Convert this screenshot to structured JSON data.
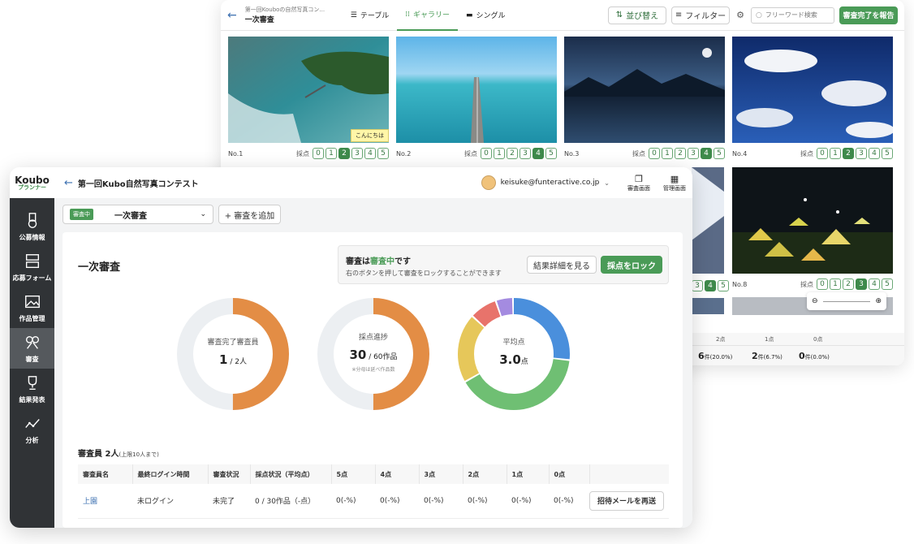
{
  "back_window": {
    "contest_short": "第一回Kouboの自然写真コン...",
    "stage_title": "一次審査",
    "views": [
      "テーブル",
      "ギャラリー",
      "シングル"
    ],
    "sort_label": "並び替え",
    "filter_label": "フィルター",
    "search_placeholder": "フリーワード検索",
    "report_label": "審査完了を報告",
    "score_label": "採点",
    "score_digits": [
      "0",
      "1",
      "2",
      "3",
      "4",
      "5"
    ],
    "tooltip": "こんにちは",
    "cards": [
      {
        "no": "No.1",
        "selected": 2
      },
      {
        "no": "No.2",
        "selected": 4
      },
      {
        "no": "No.3",
        "selected": 4
      },
      {
        "no": "No.4",
        "selected": 2
      }
    ],
    "row2_cards": [
      {
        "no": "No.8",
        "selected": 3
      }
    ],
    "score_frag": [
      "3",
      "4",
      "5"
    ],
    "dist_headers": [
      "2点",
      "1点",
      "0点"
    ],
    "dist_values": [
      {
        "count": "6",
        "unit": "件(20.0%)"
      },
      {
        "count": "2",
        "unit": "件(6.7%)"
      },
      {
        "count": "0",
        "unit": "件(0.0%)"
      }
    ],
    "colors": {
      "accent": "#4a9b57"
    }
  },
  "front_window": {
    "logo_line1": "Koubo",
    "logo_line2": "プランナー",
    "contest_title": "第一回Kubo自然写真コンテスト",
    "user_email": "keisuke@funteractive.co.jp",
    "review_screen_label": "審査画面",
    "admin_screen_label": "管理画面",
    "sidebar": [
      {
        "label": "公募情報",
        "icon": "medal-icon"
      },
      {
        "label": "応募フォーム",
        "icon": "form-icon"
      },
      {
        "label": "作品管理",
        "icon": "image-icon"
      },
      {
        "label": "審査",
        "icon": "judge-icon",
        "active": true
      },
      {
        "label": "結果発表",
        "icon": "trophy-icon"
      },
      {
        "label": "分析",
        "icon": "chart-icon"
      }
    ],
    "stage_badge": "審査中",
    "stage_select": "一次審査",
    "add_stage_label": "+ 審査を追加",
    "page_title": "一次審査",
    "status_title_prefix": "審査は",
    "status_title_highlight": "審査中",
    "status_title_suffix": "です",
    "status_desc": "右のボタンを押して審査をロックすることができます",
    "detail_button": "結果詳細を見る",
    "lock_button": "採点をロック",
    "donut1": {
      "label": "審査完了審査員",
      "value": "1",
      "suffix": " / 2人",
      "fraction": 0.5
    },
    "donut2": {
      "label": "採点進捗",
      "value": "30",
      "suffix": " / 60作品",
      "note": "※分母は延べ作品数",
      "fraction": 0.5
    },
    "donut3": {
      "label": "平均点",
      "value": "3.0",
      "suffix": "点"
    },
    "donut3_segments": [
      {
        "color": "#4a8fdc",
        "share": 0.27
      },
      {
        "color": "#6fbf73",
        "share": 0.4
      },
      {
        "color": "#e6c75a",
        "share": 0.2
      },
      {
        "color": "#e8736b",
        "share": 0.08
      },
      {
        "color": "#a48be0",
        "share": 0.05
      }
    ],
    "judges_title": "審査員 2人",
    "judges_note": "(上限10人まで)",
    "table_headers": [
      "審査員名",
      "最終ログイン時間",
      "審査状況",
      "採点状況（平均点）",
      "5点",
      "4点",
      "3点",
      "2点",
      "1点",
      "0点"
    ],
    "table_rows": [
      {
        "name": "上園",
        "last_login": "未ログイン",
        "status": "未完了",
        "progress": "0 / 30作品（-点）",
        "s5": "0(-%)",
        "s4": "0(-%)",
        "s3": "0(-%)",
        "s2": "0(-%)",
        "s1": "0(-%)",
        "s0": "0(-%)",
        "action": "招待メールを再送"
      }
    ],
    "colors": {
      "orange": "#e38d45",
      "track": "#eceff2",
      "sidebar": "#303336",
      "accent": "#4a9b57"
    }
  }
}
